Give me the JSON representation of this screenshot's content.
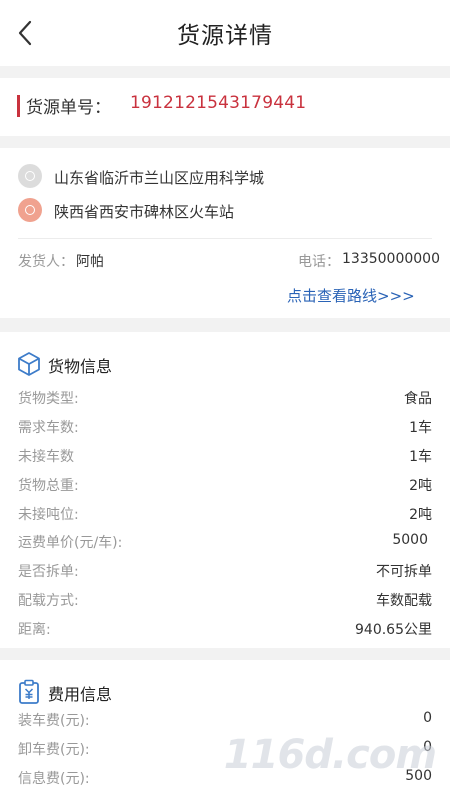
{
  "header": {
    "title": "货源详情",
    "back_icon": "chevron-left-icon"
  },
  "order": {
    "label": "货源单号：",
    "number": "1912121543179441",
    "accent": "#c9323e"
  },
  "route": {
    "start_address": "山东省临沂市兰山区应用科学城",
    "end_address": "陕西省西安市碑林区火车站",
    "shipper_label": "发货人：",
    "shipper_name": "阿帕",
    "phone_label": "电话：",
    "phone": "13350000000",
    "view_route_link": "点击查看路线>>>",
    "link_color": "#2a63b6"
  },
  "goods": {
    "title": "货物信息",
    "icon": "cube-icon",
    "rows": [
      {
        "label": "货物类型:",
        "value": "食品"
      },
      {
        "label": "需求车数:",
        "value": "1车"
      },
      {
        "label": "未接车数",
        "value": "1车"
      },
      {
        "label": "货物总重:",
        "value": "2吨"
      },
      {
        "label": "未接吨位:",
        "value": "2吨"
      },
      {
        "label": "运费单价(元/车):",
        "value": "5000"
      },
      {
        "label": "是否拆单:",
        "value": "不可拆单"
      },
      {
        "label": "配载方式:",
        "value": "车数配载"
      },
      {
        "label": "距离:",
        "value": "940.65公里"
      }
    ]
  },
  "fees": {
    "title": "费用信息",
    "icon": "fee-clipboard-icon",
    "rows": [
      {
        "label": "装车费(元):",
        "value": "0"
      },
      {
        "label": "卸车费(元):",
        "value": "0"
      },
      {
        "label": "信息费(元):",
        "value": "500"
      }
    ]
  },
  "watermark": "116d.com"
}
